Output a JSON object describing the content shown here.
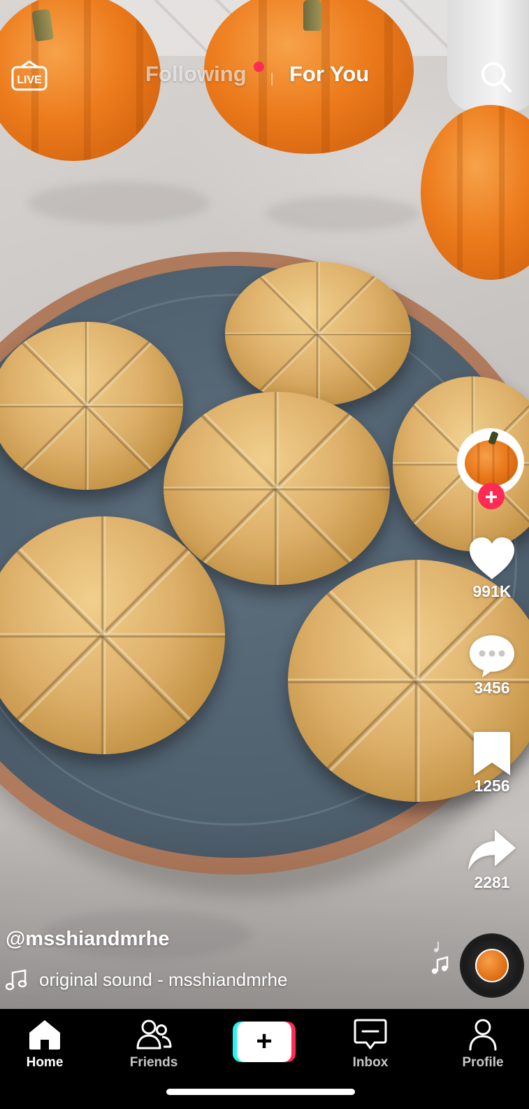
{
  "top_bar": {
    "live_label": "LIVE",
    "tabs": [
      {
        "label": "Following",
        "active": false,
        "has_notification_dot": true
      },
      {
        "label": "For You",
        "active": true
      }
    ],
    "search_icon": "search-icon"
  },
  "actions": {
    "avatar_icon": "pumpkin-avatar",
    "follow_icon": "plus-icon",
    "like": {
      "icon": "heart-icon",
      "count": "991K"
    },
    "comment": {
      "icon": "comment-icon",
      "count": "3456"
    },
    "save": {
      "icon": "bookmark-icon",
      "count": "1256"
    },
    "share": {
      "icon": "share-arrow-icon",
      "count": "2281"
    },
    "sound_disc_icon": "music-disc-icon"
  },
  "caption": {
    "username": "@msshiandmrhe",
    "sound": "original sound - msshiandmrhe"
  },
  "bottom_nav": {
    "items": [
      {
        "label": "Home",
        "icon": "home-icon",
        "active": true
      },
      {
        "label": "Friends",
        "icon": "friends-icon",
        "active": false
      },
      {
        "label": "",
        "icon": "plus-icon",
        "active": false
      },
      {
        "label": "Inbox",
        "icon": "inbox-icon",
        "active": false
      },
      {
        "label": "Profile",
        "icon": "profile-icon",
        "active": false
      }
    ]
  },
  "colors": {
    "accent_red": "#fe2c55",
    "accent_cyan": "#25f4ee",
    "nav_background": "#000000"
  }
}
